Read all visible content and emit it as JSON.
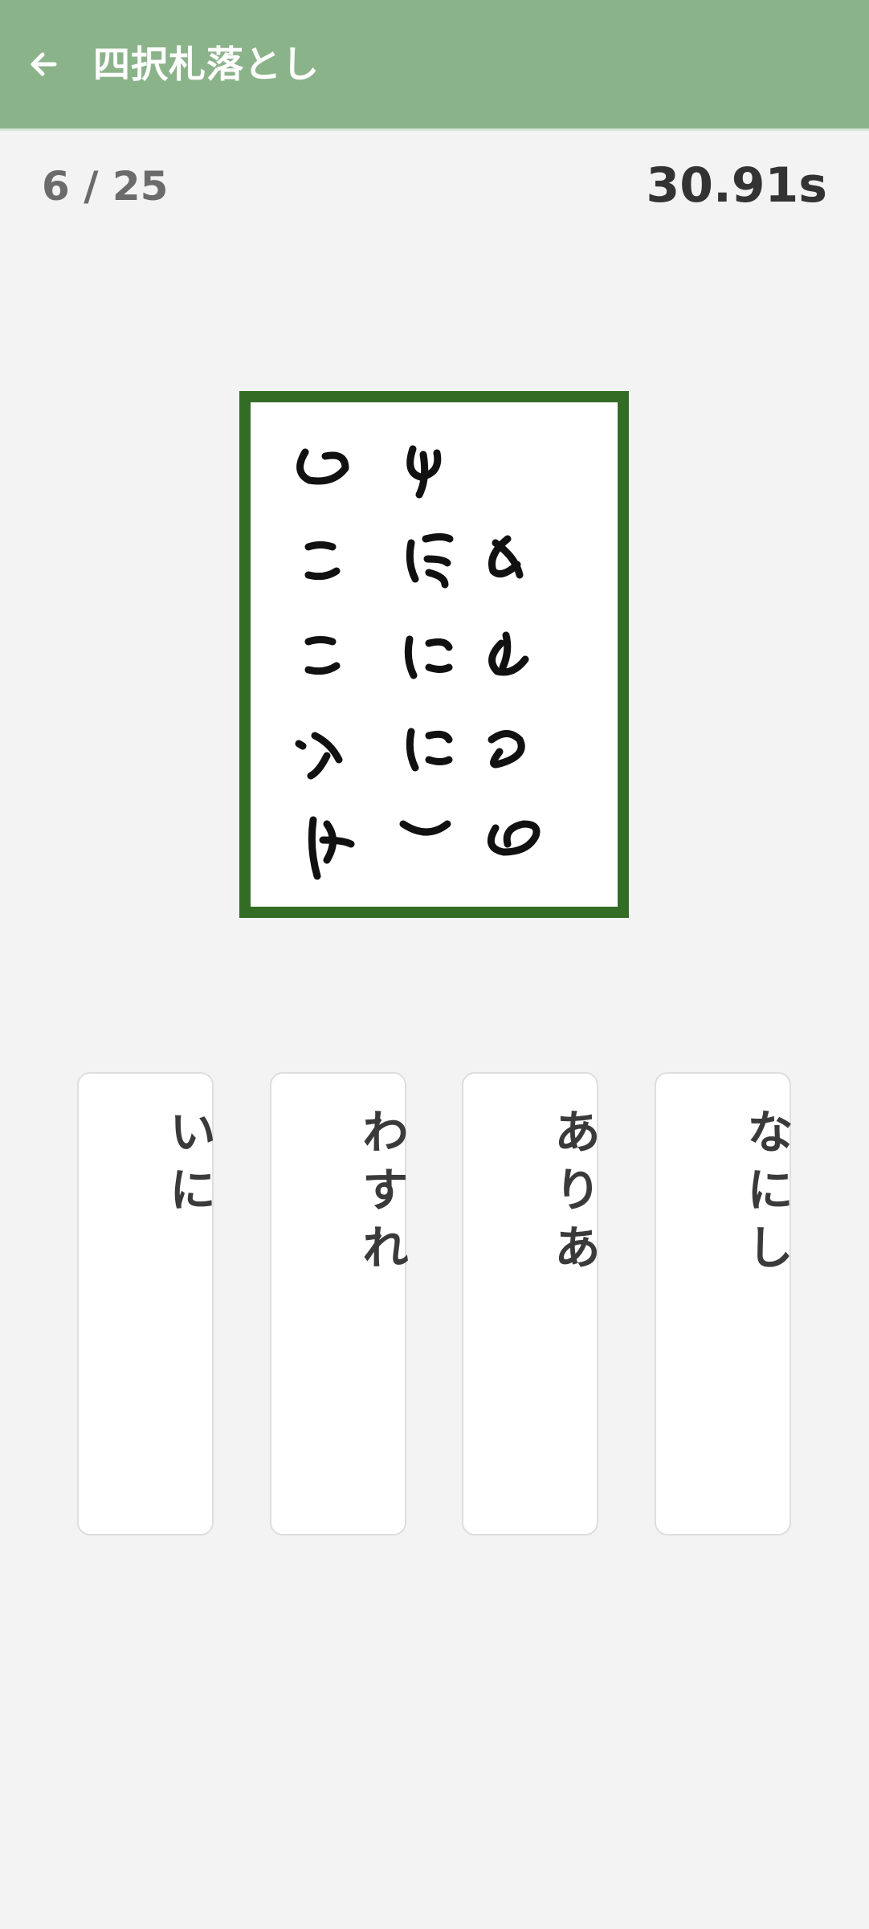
{
  "header": {
    "title": "四択札落とし",
    "back_icon": "arrow-left-icon"
  },
  "status": {
    "progress": "6 / 25",
    "timer": "30.91s"
  },
  "card": {
    "border_color": "#336c25",
    "image_description": "calligraphy-card-icon"
  },
  "choices": [
    {
      "label": "いに"
    },
    {
      "label": "わすれ"
    },
    {
      "label": "ありあ"
    },
    {
      "label": "なにし"
    }
  ],
  "colors": {
    "appbar": "#8bb38a",
    "background": "#f3f3f3",
    "text_dark": "#333333",
    "text_muted": "#6b6b6b"
  }
}
